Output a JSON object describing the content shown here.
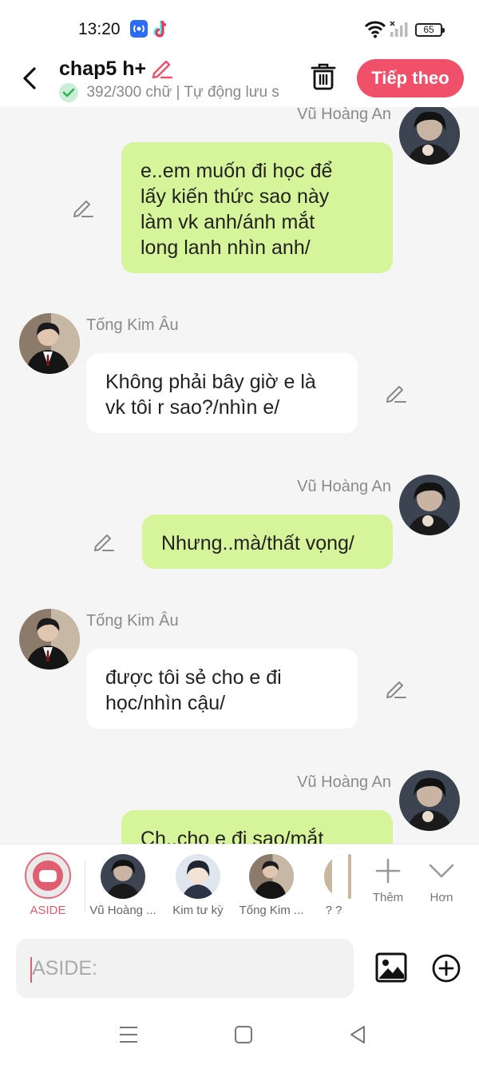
{
  "status": {
    "time": "13:20",
    "battery": "65",
    "icons": [
      "radio-icon",
      "tiktok-icon",
      "wifi-icon",
      "signal-icon",
      "battery-icon"
    ]
  },
  "header": {
    "title": "chap5 h+",
    "subtitle": "392/300 chữ | Tự động lưu s",
    "next_label": "Tiếp theo",
    "accent": "#f1506a"
  },
  "messages": [
    {
      "speaker": "Vũ Hoàng An",
      "side": "right",
      "lines": [
        "e..em muốn đi học để",
        "lấy kiến thức sao này",
        "làm vk anh/ánh mắt",
        "long lanh nhìn anh/"
      ]
    },
    {
      "speaker": "Tống Kim Âu",
      "side": "left",
      "lines": [
        "Không phải bây giờ e là",
        "vk tôi r sao?/nhìn e/"
      ]
    },
    {
      "speaker": "Vũ Hoàng An",
      "side": "right",
      "lines": [
        "Nhưng..mà/thất vọng/"
      ]
    },
    {
      "speaker": "Tống Kim Âu",
      "side": "left",
      "lines": [
        "được tôi sẻ cho e đi",
        "học/nhìn cậu/"
      ]
    },
    {
      "speaker": "Vũ Hoàng An",
      "side": "right",
      "lines": [
        "Ch..cho e đi sao/mắt"
      ]
    }
  ],
  "characters": [
    {
      "label": "ASIDE"
    },
    {
      "label": "Vũ Hoàng ..."
    },
    {
      "label": "Kim tư kỳ"
    },
    {
      "label": "Tống Kim ..."
    },
    {
      "label": "? ?"
    }
  ],
  "tools": {
    "add_label": "Thêm",
    "more_label": "Hơn"
  },
  "composer": {
    "placeholder": "ASIDE:"
  },
  "colors": {
    "green_bubble": "#d6f59a",
    "white_bubble": "#ffffff",
    "aside_accent": "#e05e6f"
  }
}
